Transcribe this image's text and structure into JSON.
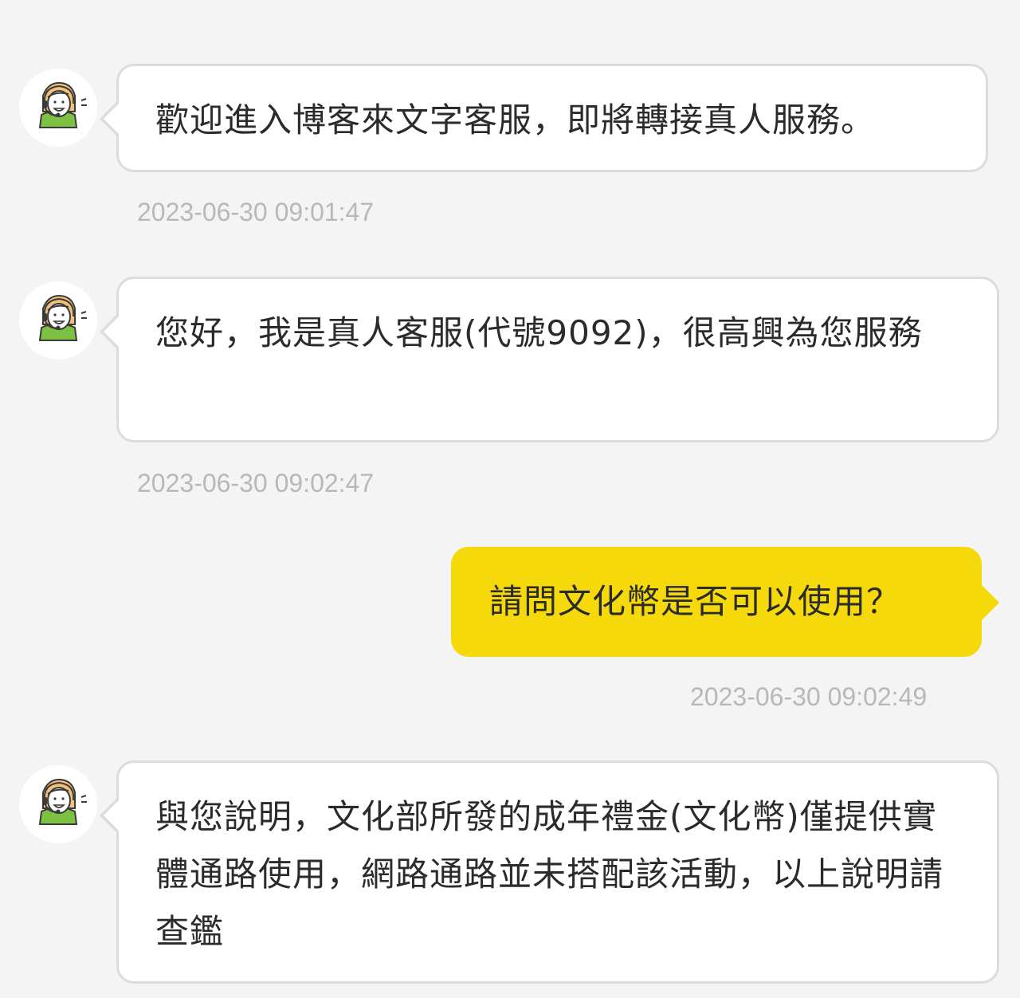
{
  "messages": [
    {
      "sender": "agent",
      "text": "歡迎進入博客來文字客服，即將轉接真人服務。",
      "time": "2023-06-30 09:01:47"
    },
    {
      "sender": "agent",
      "text": "您好，我是真人客服(代號9092)，很高興為您服務",
      "time": "2023-06-30 09:02:47"
    },
    {
      "sender": "user",
      "text": "請問文化幣是否可以使用？",
      "time": "2023-06-30 09:02:49"
    },
    {
      "sender": "agent",
      "text": "與您說明，文化部所發的成年禮金(文化幣)僅提供實體通路使用，網路通路並未搭配該活動，以上說明請查鑑",
      "time": ""
    }
  ],
  "colors": {
    "background": "#f4f4f4",
    "user_bubble": "#f5d90b",
    "agent_bubble": "#ffffff",
    "timestamp": "#b8b8b8"
  },
  "icons": {
    "agent_avatar": "customer-service-agent-headset-icon"
  }
}
